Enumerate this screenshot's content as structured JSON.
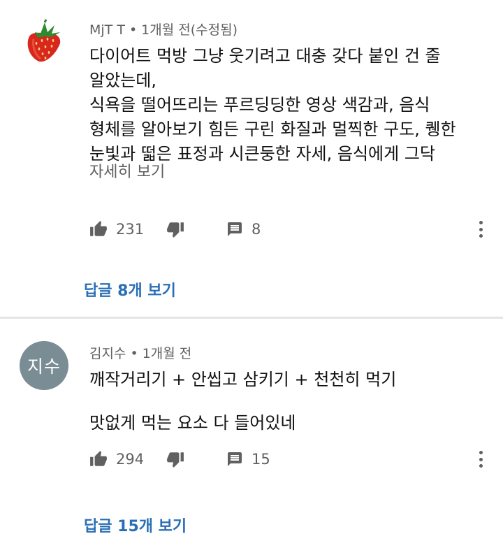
{
  "comments": [
    {
      "author": "MjT T",
      "time": "1개월 전(수정됨)",
      "body_lines": [
        "다이어트 먹방 그냥 웃기려고 대충 갖다 붙인 건 줄",
        "알았는데,",
        "식욕을 떨어뜨리는 푸르딩딩한 영상 색감과, 음식",
        "형체를 알아보기 힘든 구린 화질과 멀찍한 구도, 퀭한",
        "눈빛과 떫은 표정과 시큰둥한 자세, 음식에게 그닥"
      ],
      "read_more": "자세히 보기",
      "likes": "231",
      "replies_count": "8",
      "view_replies": "답글 8개 보기",
      "avatar_icon": "strawberry-icon"
    },
    {
      "author": "김지수",
      "time": "1개월 전",
      "avatar_text": "지수",
      "avatar_color": "#7a8c94",
      "body_lines": [
        "깨작거리기 + 안씹고 삼키기 + 천천히 먹기",
        "맛없게 먹는 요소 다 들어있네"
      ],
      "likes": "294",
      "replies_count": "15",
      "view_replies": "답글 15개 보기"
    }
  ],
  "separator": "•",
  "colors": {
    "link": "#2a6fb5",
    "meta": "#606060",
    "text": "#111111",
    "divider": "#e4e4e4"
  }
}
